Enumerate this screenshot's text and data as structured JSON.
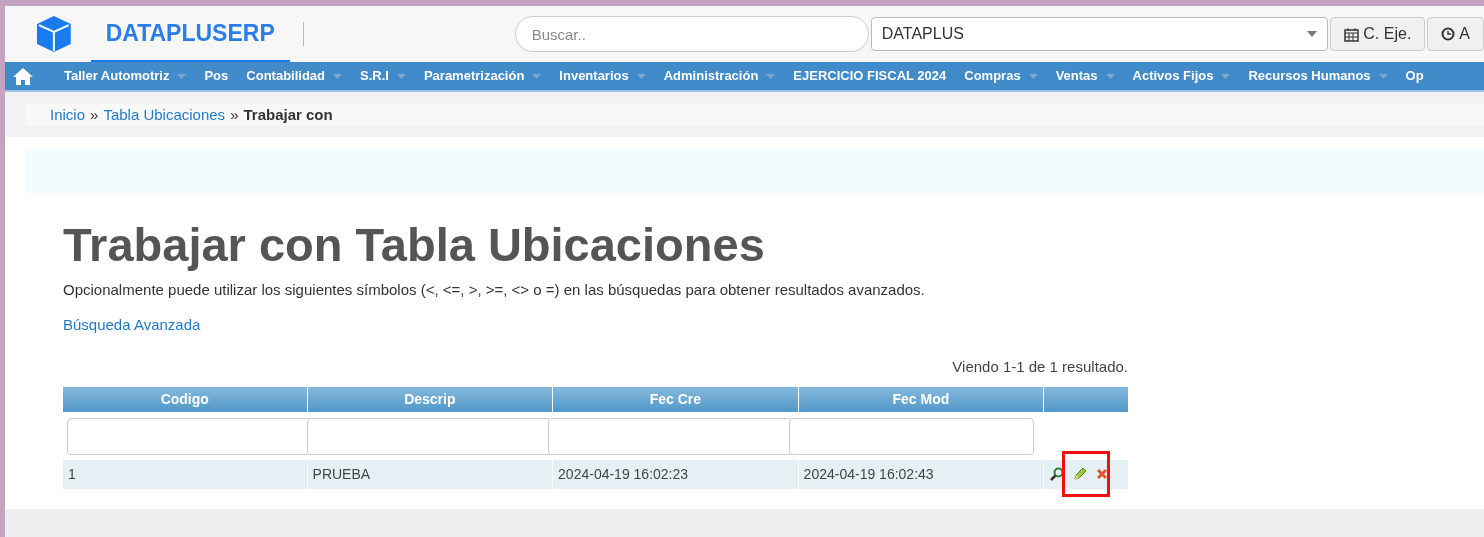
{
  "header": {
    "brand": "DATAPLUSERP",
    "search": {
      "placeholder": "Buscar.."
    },
    "company_select": {
      "value": "DATAPLUS"
    },
    "buttons": [
      {
        "label": "C. Eje.",
        "kind": "calendar"
      },
      {
        "label": "A",
        "kind": "clock"
      }
    ]
  },
  "nav": [
    {
      "label": "Taller Automotriz",
      "has_menu": true
    },
    {
      "label": "Pos",
      "has_menu": false
    },
    {
      "label": "Contabilidad",
      "has_menu": true
    },
    {
      "label": "S.R.I",
      "has_menu": true
    },
    {
      "label": "Parametrización",
      "has_menu": true
    },
    {
      "label": "Inventarios",
      "has_menu": true
    },
    {
      "label": "Administración",
      "has_menu": true
    },
    {
      "label": "EJERCICIO FISCAL 2024",
      "has_menu": false
    },
    {
      "label": "Compras",
      "has_menu": true
    },
    {
      "label": "Ventas",
      "has_menu": true
    },
    {
      "label": "Activos Fijos",
      "has_menu": true
    },
    {
      "label": "Recursos Humanos",
      "has_menu": true
    },
    {
      "label": "Op",
      "has_menu": false
    }
  ],
  "breadcrumb": {
    "links": [
      "Inicio",
      "Tabla Ubicaciones"
    ],
    "separator": "»",
    "current": "Trabajar con"
  },
  "title": "Trabajar con Tabla Ubicaciones",
  "description": "Opcionalmente puede utilizar los siguientes símbolos (<, <=, >, >=, <> o =) en las búsquedas para obtener resultados avanzados.",
  "advanced_search_link": "Búsqueda Avanzada",
  "summary": "Viendo 1-1 de 1 resultado.",
  "table": {
    "columns": [
      "Codigo",
      "Descrip",
      "Fec Cre",
      "Fec Mod"
    ],
    "rows": [
      {
        "cells": [
          "1",
          "PRUEBA",
          "2024-04-19 16:02:23",
          "2024-04-19 16:02:43"
        ],
        "actions": [
          {
            "kind": "view"
          },
          {
            "kind": "edit"
          },
          {
            "kind": "delete"
          }
        ]
      }
    ]
  },
  "highlight": {
    "on": true
  }
}
